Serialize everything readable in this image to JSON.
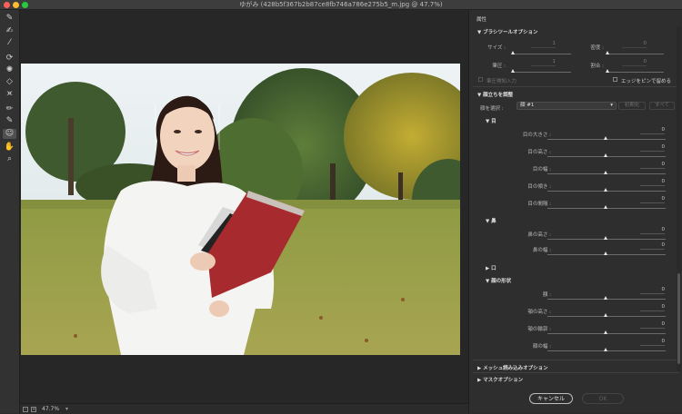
{
  "window": {
    "title": "ゆがみ (428b5f367b2b87ce8fb746a786e275b5_m.jpg @ 47.7%)",
    "close_color": "#ff5f57",
    "minimize_color": "#febc2e",
    "zoom_color": "#28c840"
  },
  "tools": [
    "forward-warp-tool",
    "reconstruct-tool",
    "smooth-tool",
    "twirl-clockwise-tool",
    "pucker-tool",
    "bloat-tool",
    "push-left-tool",
    "freeze-mask-tool",
    "thaw-mask-tool",
    "face-tool",
    "hand-tool",
    "zoom-tool"
  ],
  "statusbar": {
    "zoom": "47.7%"
  },
  "panel": {
    "header": "属性",
    "brush": {
      "section": "ブラシツールオプション",
      "size_label": "サイズ :",
      "size_value": "1",
      "density_label": "密度 :",
      "density_value": "0",
      "pressure_label": "筆圧 :",
      "pressure_value": "1",
      "rate_label": "割合 :",
      "rate_value": "0",
      "stylus_label": "筆圧検知入力",
      "pin_edges_label": "エッジをピンで留める"
    },
    "face": {
      "section": "顔立ちを調整",
      "select_label": "顔を選択 :",
      "select_value": "顔 #1",
      "reset_label": "初期化",
      "all_label": "すべて",
      "eyes": {
        "section": "目",
        "rows": [
          {
            "label": "目の大きさ :",
            "value": "0"
          },
          {
            "label": "目の高さ :",
            "value": "0"
          },
          {
            "label": "目の幅 :",
            "value": "0"
          },
          {
            "label": "目の傾き :",
            "value": "0"
          },
          {
            "label": "目の間隔 :",
            "value": "0"
          }
        ]
      },
      "nose": {
        "section": "鼻",
        "rows": [
          {
            "label": "鼻の高さ :",
            "value": "0"
          },
          {
            "label": "鼻の幅 :",
            "value": "0"
          }
        ]
      },
      "mouth": {
        "section": "口"
      },
      "shape": {
        "section": "顔の形状",
        "rows": [
          {
            "label": "額 :",
            "value": "0"
          },
          {
            "label": "顎の高さ :",
            "value": "0"
          },
          {
            "label": "顎の輪郭 :",
            "value": "0"
          },
          {
            "label": "顔の幅 :",
            "value": "0"
          }
        ]
      }
    },
    "mesh_section": "メッシュ読み込みオプション",
    "mask_section": "マスクオプション",
    "cancel_label": "キャンセル",
    "ok_label": "OK"
  }
}
